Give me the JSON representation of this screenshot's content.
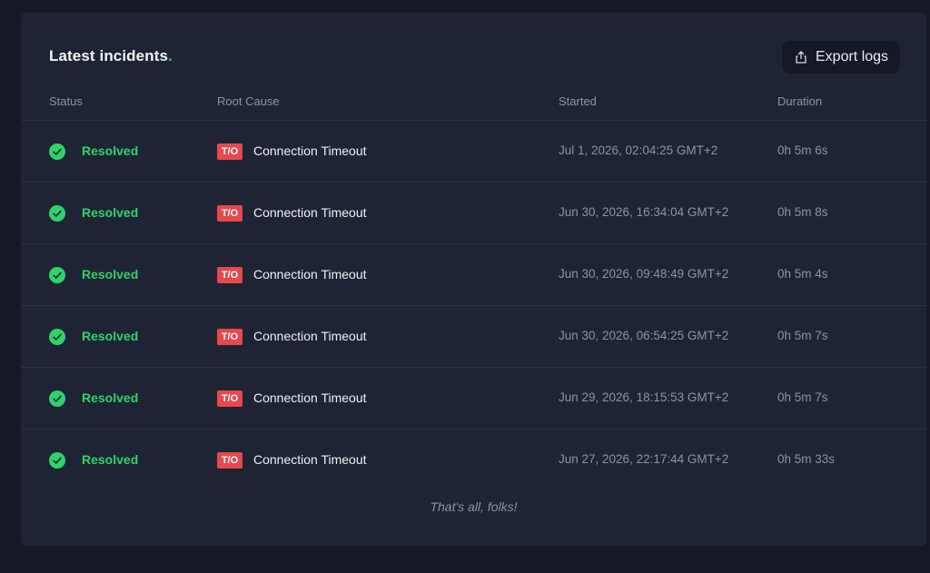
{
  "header": {
    "title": "Latest incidents",
    "title_dot": ".",
    "export_label": "Export logs"
  },
  "columns": {
    "status": "Status",
    "root_cause": "Root Cause",
    "started": "Started",
    "duration": "Duration"
  },
  "incidents": [
    {
      "status": "Resolved",
      "badge": "T/O",
      "cause": "Connection Timeout",
      "started": "Jul 1, 2026, 02:04:25 GMT+2",
      "duration": "0h 5m 6s"
    },
    {
      "status": "Resolved",
      "badge": "T/O",
      "cause": "Connection Timeout",
      "started": "Jun 30, 2026, 16:34:04 GMT+2",
      "duration": "0h 5m 8s"
    },
    {
      "status": "Resolved",
      "badge": "T/O",
      "cause": "Connection Timeout",
      "started": "Jun 30, 2026, 09:48:49 GMT+2",
      "duration": "0h 5m 4s"
    },
    {
      "status": "Resolved",
      "badge": "T/O",
      "cause": "Connection Timeout",
      "started": "Jun 30, 2026, 06:54:25 GMT+2",
      "duration": "0h 5m 7s"
    },
    {
      "status": "Resolved",
      "badge": "T/O",
      "cause": "Connection Timeout",
      "started": "Jun 29, 2026, 18:15:53 GMT+2",
      "duration": "0h 5m 7s"
    },
    {
      "status": "Resolved",
      "badge": "T/O",
      "cause": "Connection Timeout",
      "started": "Jun 27, 2026, 22:17:44 GMT+2",
      "duration": "0h 5m 33s"
    }
  ],
  "footer": {
    "note": "That's all, folks!"
  },
  "colors": {
    "accent_green": "#2fd36b",
    "badge_red": "#e5484d",
    "panel_bg": "#1e2433",
    "page_bg": "#141925"
  },
  "icons": {
    "export": "share-upload-icon",
    "status": "check-circle-icon"
  }
}
